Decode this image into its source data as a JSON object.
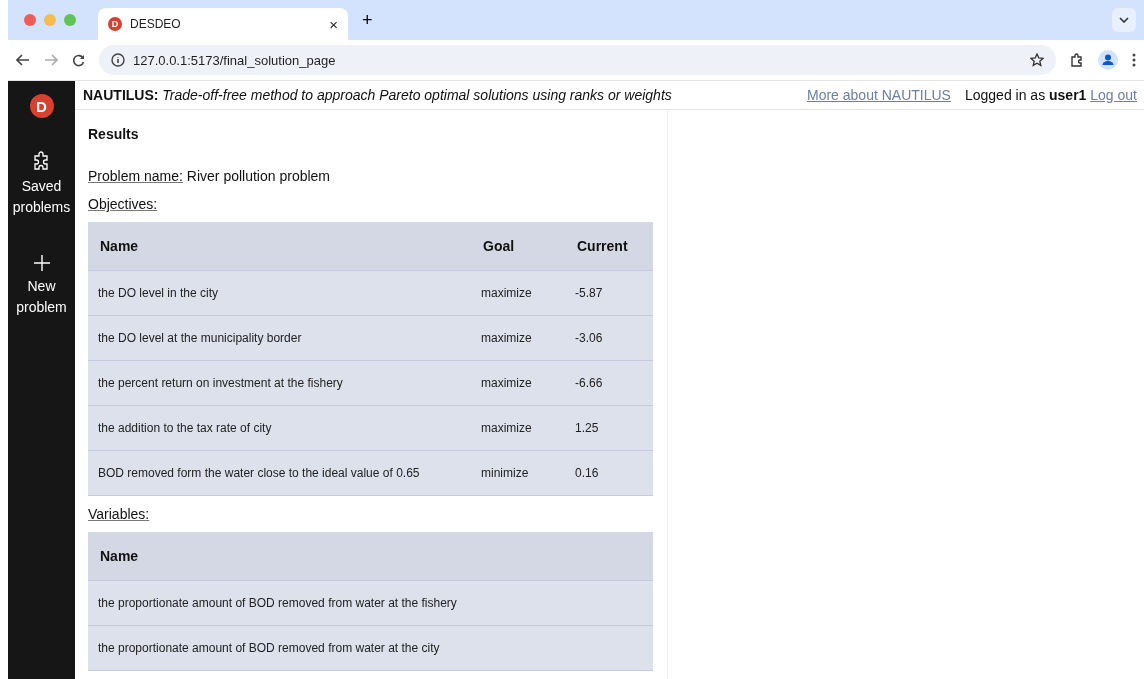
{
  "browser": {
    "favicon": "D",
    "tab_title": "DESDEO",
    "tab_close": "×",
    "new_tab": "+",
    "url": "127.0.0.1:5173/final_solution_page"
  },
  "sidebar": {
    "logo": "D",
    "items": [
      {
        "label": "Saved problems",
        "kind": "puzzle"
      },
      {
        "label": "New problem",
        "kind": "plus"
      }
    ]
  },
  "header": {
    "method": "NAUTILUS:",
    "description": "Trade-off-free method to approach Pareto optimal solutions using ranks or weights",
    "more_link": "More about NAUTILUS",
    "login": "Logged in as **user1**",
    "logout": "Log out"
  },
  "content": {
    "title": "Results",
    "problem_label": "Problem name:",
    "problem_name": "River pollution problem",
    "objectives_label": "Objectives:",
    "objectives": {
      "columns": [
        "Name",
        "Goal",
        "Current"
      ],
      "rows": [
        [
          "the DO level in the city",
          "maximize",
          "-5.87"
        ],
        [
          "the DO level at the municipality border",
          "maximize",
          "-3.06"
        ],
        [
          "the percent return on investment at the fishery",
          "maximize",
          "-6.66"
        ],
        [
          "the addition to the tax rate of city",
          "maximize",
          "1.25"
        ],
        [
          "BOD removed form the water close to the ideal value of 0.65",
          "minimize",
          "0.16"
        ]
      ]
    },
    "variables_label": "Variables:",
    "variables": {
      "columns": [
        "Name"
      ],
      "rows": [
        [
          "the proportionate amount of BOD removed from water at the fishery"
        ],
        [
          "the proportionate amount of BOD removed from water at the city"
        ]
      ]
    }
  }
}
